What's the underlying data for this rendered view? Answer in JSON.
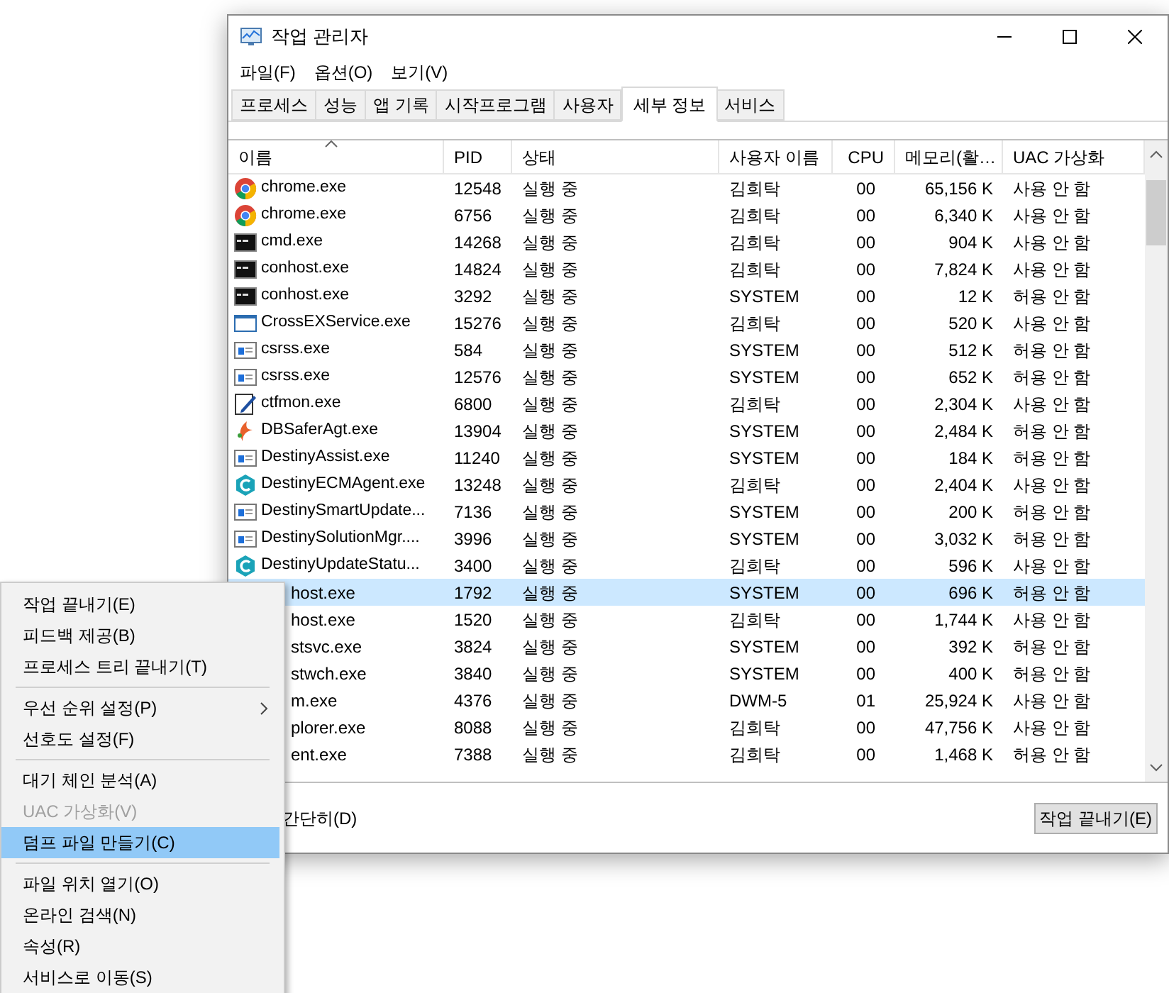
{
  "window": {
    "title": "작업 관리자"
  },
  "menu_bar": [
    "파일(F)",
    "옵션(O)",
    "보기(V)"
  ],
  "tabs": [
    {
      "label": "프로세스",
      "selected": false
    },
    {
      "label": "성능",
      "selected": false
    },
    {
      "label": "앱 기록",
      "selected": false
    },
    {
      "label": "시작프로그램",
      "selected": false
    },
    {
      "label": "사용자",
      "selected": false
    },
    {
      "label": "세부 정보",
      "selected": true
    },
    {
      "label": "서비스",
      "selected": false
    }
  ],
  "table": {
    "columns": [
      "이름",
      "PID",
      "상태",
      "사용자 이름",
      "CPU",
      "메모리(활…",
      "UAC 가상화"
    ],
    "rows": [
      {
        "kind": "chrome",
        "name": "chrome.exe",
        "pid": "12548",
        "status": "실행 중",
        "user": "김희탁",
        "cpu": "00",
        "memory": "65,156 K",
        "uac": "사용 안 함",
        "selected": false
      },
      {
        "kind": "chrome",
        "name": "chrome.exe",
        "pid": "6756",
        "status": "실행 중",
        "user": "김희탁",
        "cpu": "00",
        "memory": "6,340 K",
        "uac": "사용 안 함",
        "selected": false
      },
      {
        "kind": "console",
        "name": "cmd.exe",
        "pid": "14268",
        "status": "실행 중",
        "user": "김희탁",
        "cpu": "00",
        "memory": "904 K",
        "uac": "사용 안 함",
        "selected": false
      },
      {
        "kind": "console",
        "name": "conhost.exe",
        "pid": "14824",
        "status": "실행 중",
        "user": "김희탁",
        "cpu": "00",
        "memory": "7,824 K",
        "uac": "사용 안 함",
        "selected": false
      },
      {
        "kind": "console",
        "name": "conhost.exe",
        "pid": "3292",
        "status": "실행 중",
        "user": "SYSTEM",
        "cpu": "00",
        "memory": "12 K",
        "uac": "허용 안 함",
        "selected": false
      },
      {
        "kind": "window",
        "name": "CrossEXService.exe",
        "pid": "15276",
        "status": "실행 중",
        "user": "김희탁",
        "cpu": "00",
        "memory": "520 K",
        "uac": "사용 안 함",
        "selected": false
      },
      {
        "kind": "app",
        "name": "csrss.exe",
        "pid": "584",
        "status": "실행 중",
        "user": "SYSTEM",
        "cpu": "00",
        "memory": "512 K",
        "uac": "허용 안 함",
        "selected": false
      },
      {
        "kind": "app",
        "name": "csrss.exe",
        "pid": "12576",
        "status": "실행 중",
        "user": "SYSTEM",
        "cpu": "00",
        "memory": "652 K",
        "uac": "허용 안 함",
        "selected": false
      },
      {
        "kind": "pen",
        "name": "ctfmon.exe",
        "pid": "6800",
        "status": "실행 중",
        "user": "김희탁",
        "cpu": "00",
        "memory": "2,304 K",
        "uac": "사용 안 함",
        "selected": false
      },
      {
        "kind": "flame",
        "name": "DBSaferAgt.exe",
        "pid": "13904",
        "status": "실행 중",
        "user": "SYSTEM",
        "cpu": "00",
        "memory": "2,484 K",
        "uac": "허용 안 함",
        "selected": false
      },
      {
        "kind": "app",
        "name": "DestinyAssist.exe",
        "pid": "11240",
        "status": "실행 중",
        "user": "SYSTEM",
        "cpu": "00",
        "memory": "184 K",
        "uac": "허용 안 함",
        "selected": false
      },
      {
        "kind": "hexagon",
        "name": "DestinyECMAgent.exe",
        "pid": "13248",
        "status": "실행 중",
        "user": "김희탁",
        "cpu": "00",
        "memory": "2,404 K",
        "uac": "사용 안 함",
        "selected": false
      },
      {
        "kind": "app",
        "name": "DestinySmartUpdate...",
        "pid": "7136",
        "status": "실행 중",
        "user": "SYSTEM",
        "cpu": "00",
        "memory": "200 K",
        "uac": "허용 안 함",
        "selected": false
      },
      {
        "kind": "app",
        "name": "DestinySolutionMgr....",
        "pid": "3996",
        "status": "실행 중",
        "user": "SYSTEM",
        "cpu": "00",
        "memory": "3,032 K",
        "uac": "허용 안 함",
        "selected": false
      },
      {
        "kind": "hexagon",
        "name": "DestinyUpdateStatu...",
        "pid": "3400",
        "status": "실행 중",
        "user": "김희탁",
        "cpu": "00",
        "memory": "596 K",
        "uac": "사용 안 함",
        "selected": false
      },
      {
        "name": "host.exe",
        "pid": "1792",
        "status": "실행 중",
        "user": "SYSTEM",
        "cpu": "00",
        "memory": "696 K",
        "uac": "허용 안 함",
        "selected": true
      },
      {
        "name": "host.exe",
        "pid": "1520",
        "status": "실행 중",
        "user": "김희탁",
        "cpu": "00",
        "memory": "1,744 K",
        "uac": "사용 안 함",
        "selected": false
      },
      {
        "name": "stsvc.exe",
        "pid": "3824",
        "status": "실행 중",
        "user": "SYSTEM",
        "cpu": "00",
        "memory": "392 K",
        "uac": "허용 안 함",
        "selected": false
      },
      {
        "name": "stwch.exe",
        "pid": "3840",
        "status": "실행 중",
        "user": "SYSTEM",
        "cpu": "00",
        "memory": "400 K",
        "uac": "허용 안 함",
        "selected": false
      },
      {
        "name": "m.exe",
        "pid": "4376",
        "status": "실행 중",
        "user": "DWM-5",
        "cpu": "01",
        "memory": "25,924 K",
        "uac": "사용 안 함",
        "selected": false
      },
      {
        "name": "plorer.exe",
        "pid": "8088",
        "status": "실행 중",
        "user": "김희탁",
        "cpu": "00",
        "memory": "47,756 K",
        "uac": "사용 안 함",
        "selected": false
      },
      {
        "name": "ent.exe",
        "pid": "7388",
        "status": "실행 중",
        "user": "김희탁",
        "cpu": "00",
        "memory": "1,468 K",
        "uac": "허용 안 함",
        "selected": false
      }
    ]
  },
  "footer": {
    "less_details": "간단히(D)",
    "end_task": "작업 끝내기(E)"
  },
  "context_menu": {
    "items": [
      {
        "kind": "item",
        "label": "작업 끝내기(E)",
        "disabled": false,
        "selected": false,
        "submenu": false
      },
      {
        "kind": "item",
        "label": "피드백 제공(B)",
        "disabled": false,
        "selected": false,
        "submenu": false
      },
      {
        "kind": "item",
        "label": "프로세스 트리 끝내기(T)",
        "disabled": false,
        "selected": false,
        "submenu": false
      },
      {
        "kind": "separator"
      },
      {
        "kind": "item",
        "label": "우선 순위 설정(P)",
        "disabled": false,
        "selected": false,
        "submenu": true
      },
      {
        "kind": "item",
        "label": "선호도 설정(F)",
        "disabled": false,
        "selected": false,
        "submenu": false
      },
      {
        "kind": "separator"
      },
      {
        "kind": "item",
        "label": "대기 체인 분석(A)",
        "disabled": false,
        "selected": false,
        "submenu": false
      },
      {
        "kind": "item",
        "label": "UAC 가상화(V)",
        "disabled": true,
        "selected": false,
        "submenu": false
      },
      {
        "kind": "item",
        "label": "덤프 파일 만들기(C)",
        "disabled": false,
        "selected": true,
        "submenu": false
      },
      {
        "kind": "separator"
      },
      {
        "kind": "item",
        "label": "파일 위치 열기(O)",
        "disabled": false,
        "selected": false,
        "submenu": false
      },
      {
        "kind": "item",
        "label": "온라인 검색(N)",
        "disabled": false,
        "selected": false,
        "submenu": false
      },
      {
        "kind": "item",
        "label": "속성(R)",
        "disabled": false,
        "selected": false,
        "submenu": false
      },
      {
        "kind": "item",
        "label": "서비스로 이동(S)",
        "disabled": false,
        "selected": false,
        "submenu": false
      }
    ]
  }
}
